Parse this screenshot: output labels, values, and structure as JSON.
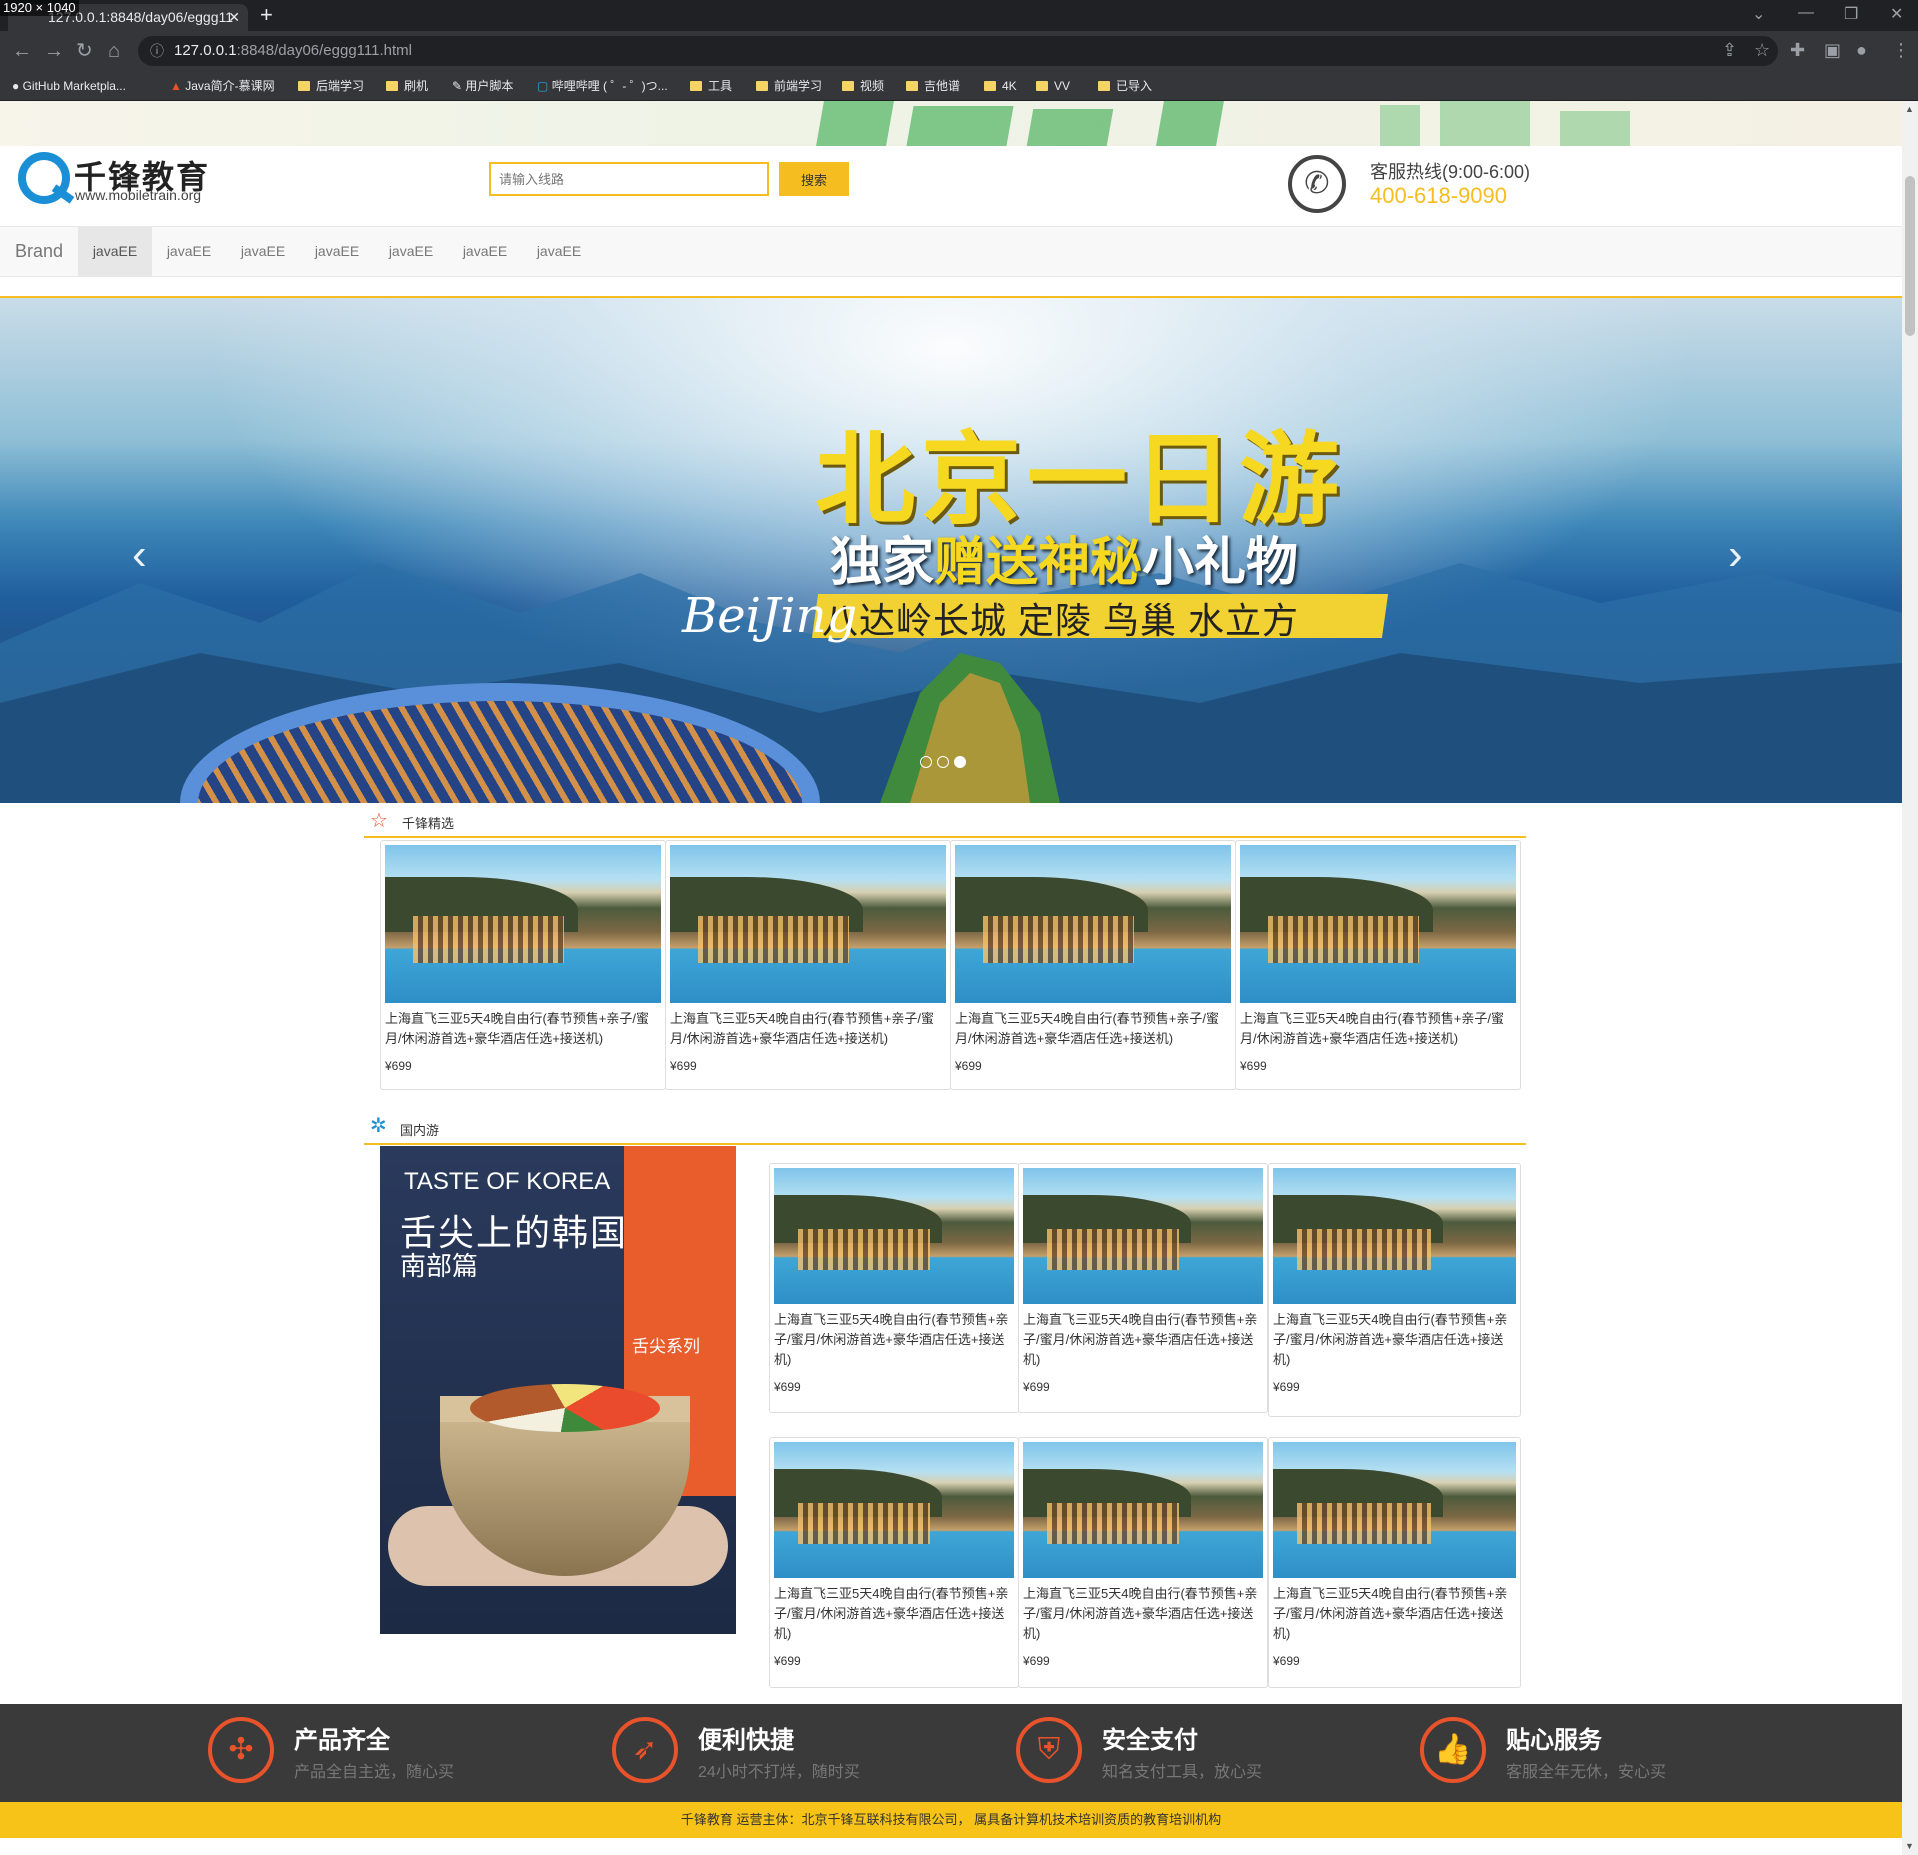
{
  "screen_size_label": "1920 × 1040",
  "browser": {
    "tab_title": "127.0.0.1:8848/day06/eggg11",
    "url_host": "127.0.0.1",
    "url_rest": ":8848/day06/eggg111.html",
    "bookmarks": [
      "GitHub Marketpla...",
      "Java简介-慕课网",
      "后端学习",
      "刷机",
      "用户脚本",
      "哔哩哔哩 ( ゜- ゜)つ...",
      "工具",
      "前端学习",
      "视频",
      "吉他谱",
      "4K",
      "VV",
      "已导入"
    ]
  },
  "header": {
    "logo_cn": "千锋教育",
    "logo_url": "www.mobiletrain.org",
    "search_placeholder": "请输入线路",
    "search_button": "搜索",
    "hotline_label": "客服热线(9:00-6:00)",
    "hotline_number": "400-618-9090"
  },
  "nav": {
    "brand": "Brand",
    "items": [
      "javaEE",
      "javaEE",
      "javaEE",
      "javaEE",
      "javaEE",
      "javaEE",
      "javaEE"
    ],
    "active_index": 0
  },
  "carousel": {
    "title": "北京一日游",
    "subtitle_pre": "独家",
    "subtitle_hl": "赠送神秘",
    "subtitle_post": "小礼物",
    "places": "八达岭长城 定陵 鸟巢 水立方",
    "script_text": "BeiJing",
    "prev": "‹",
    "next": "›",
    "slide_count": 3,
    "active_slide": 2
  },
  "section1": {
    "title": "千锋精选",
    "cards": [
      {
        "desc": "上海直飞三亚5天4晚自由行(春节预售+亲子/蜜月/休闲游首选+豪华酒店任选+接送机)",
        "price": "¥699"
      },
      {
        "desc": "上海直飞三亚5天4晚自由行(春节预售+亲子/蜜月/休闲游首选+豪华酒店任选+接送机)",
        "price": "¥699"
      },
      {
        "desc": "上海直飞三亚5天4晚自由行(春节预售+亲子/蜜月/休闲游首选+豪华酒店任选+接送机)",
        "price": "¥699"
      },
      {
        "desc": "上海直飞三亚5天4晚自由行(春节预售+亲子/蜜月/休闲游首选+豪华酒店任选+接送机)",
        "price": "¥699"
      }
    ]
  },
  "section2": {
    "title": "国内游",
    "korea": {
      "title1": "TASTE OF KOREA",
      "title2": "舌尖上的韩国",
      "title3": "南部篇",
      "series": "舌尖系列"
    },
    "cards": [
      {
        "desc": "上海直飞三亚5天4晚自由行(春节预售+亲子/蜜月/休闲游首选+豪华酒店任选+接送机)",
        "price": "¥699"
      },
      {
        "desc": "上海直飞三亚5天4晚自由行(春节预售+亲子/蜜月/休闲游首选+豪华酒店任选+接送机)",
        "price": "¥699"
      },
      {
        "desc": "上海直飞三亚5天4晚自由行(春节预售+亲子/蜜月/休闲游首选+豪华酒店任选+接送机)",
        "price": "¥699"
      },
      {
        "desc": "上海直飞三亚5天4晚自由行(春节预售+亲子/蜜月/休闲游首选+豪华酒店任选+接送机)",
        "price": "¥699"
      },
      {
        "desc": "上海直飞三亚5天4晚自由行(春节预售+亲子/蜜月/休闲游首选+豪华酒店任选+接送机)",
        "price": "¥699"
      },
      {
        "desc": "上海直飞三亚5天4晚自由行(春节预售+亲子/蜜月/休闲游首选+豪华酒店任选+接送机)",
        "price": "¥699"
      }
    ]
  },
  "features": [
    {
      "icon": "grid-icon",
      "title": "产品齐全",
      "sub": "产品全自主选，随心买"
    },
    {
      "icon": "rocket-icon",
      "title": "便利快捷",
      "sub": "24小时不打烊，随时买"
    },
    {
      "icon": "shield-icon",
      "title": "安全支付",
      "sub": "知名支付工具，放心买"
    },
    {
      "icon": "thumbs-up-icon",
      "title": "贴心服务",
      "sub": "客服全年无休，安心买"
    }
  ],
  "footer_text": "千锋教育 运营主体：北京千锋互联科技有限公司， 属具备计算机技术培训资质的教育培训机构",
  "colors": {
    "accent": "#f5bd1f",
    "feature_icon": "#e9532b",
    "footer_dark": "#3a3a3a"
  }
}
